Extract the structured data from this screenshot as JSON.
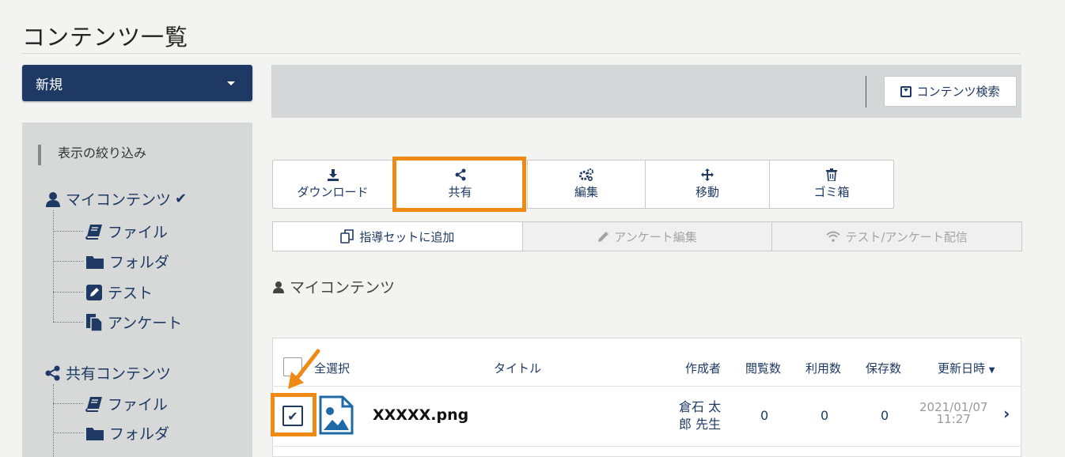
{
  "page": {
    "title": "コンテンツ一覧"
  },
  "new_menu": {
    "label": "新規"
  },
  "sidebar": {
    "filter_title": "表示の絞り込み",
    "my_contents": {
      "label": "マイコンテンツ",
      "check": "✔",
      "children": [
        "ファイル",
        "フォルダ",
        "テスト",
        "アンケート"
      ]
    },
    "shared_contents": {
      "label": "共有コンテンツ",
      "children": [
        "ファイル",
        "フォルダ"
      ]
    }
  },
  "toolbar": {
    "search_label": "コンテンツ検索"
  },
  "actions": {
    "download": "ダウンロード",
    "share": "共有",
    "edit": "編集",
    "move": "移動",
    "trash": "ゴミ箱"
  },
  "sub_actions": {
    "add_guide_set": "指導セットに追加",
    "edit_survey": "アンケート編集",
    "deliver": "テスト/アンケート配信"
  },
  "section": {
    "title": "マイコンテンツ"
  },
  "table": {
    "select_all": "全選択",
    "headers": {
      "title": "タイトル",
      "creator": "作成者",
      "views": "閲覧数",
      "uses": "利用数",
      "saves": "保存数",
      "updated": "更新日時"
    },
    "rows": [
      {
        "name": "XXXXX.png",
        "creator_line1": "倉石 太",
        "creator_line2": "郎 先生",
        "views": "0",
        "uses": "0",
        "saves": "0",
        "date": "2021/01/07",
        "time": "11:27",
        "checked": true
      }
    ]
  },
  "colors": {
    "brand": "#1e3a64",
    "highlight": "#ef8a14",
    "sidebar_bg": "#d7d8d8"
  }
}
